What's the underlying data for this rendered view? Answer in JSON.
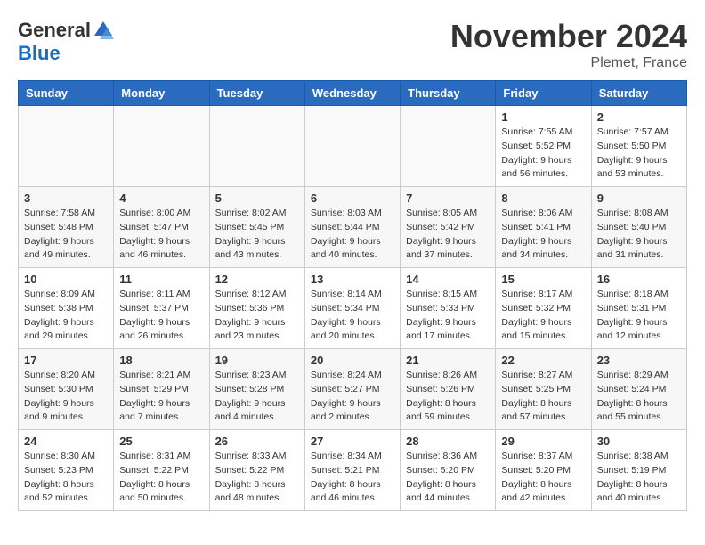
{
  "header": {
    "logo_line1": "General",
    "logo_line2": "Blue",
    "month": "November 2024",
    "location": "Plemet, France"
  },
  "weekdays": [
    "Sunday",
    "Monday",
    "Tuesday",
    "Wednesday",
    "Thursday",
    "Friday",
    "Saturday"
  ],
  "weeks": [
    [
      {
        "day": "",
        "info": ""
      },
      {
        "day": "",
        "info": ""
      },
      {
        "day": "",
        "info": ""
      },
      {
        "day": "",
        "info": ""
      },
      {
        "day": "",
        "info": ""
      },
      {
        "day": "1",
        "info": "Sunrise: 7:55 AM\nSunset: 5:52 PM\nDaylight: 9 hours\nand 56 minutes."
      },
      {
        "day": "2",
        "info": "Sunrise: 7:57 AM\nSunset: 5:50 PM\nDaylight: 9 hours\nand 53 minutes."
      }
    ],
    [
      {
        "day": "3",
        "info": "Sunrise: 7:58 AM\nSunset: 5:48 PM\nDaylight: 9 hours\nand 49 minutes."
      },
      {
        "day": "4",
        "info": "Sunrise: 8:00 AM\nSunset: 5:47 PM\nDaylight: 9 hours\nand 46 minutes."
      },
      {
        "day": "5",
        "info": "Sunrise: 8:02 AM\nSunset: 5:45 PM\nDaylight: 9 hours\nand 43 minutes."
      },
      {
        "day": "6",
        "info": "Sunrise: 8:03 AM\nSunset: 5:44 PM\nDaylight: 9 hours\nand 40 minutes."
      },
      {
        "day": "7",
        "info": "Sunrise: 8:05 AM\nSunset: 5:42 PM\nDaylight: 9 hours\nand 37 minutes."
      },
      {
        "day": "8",
        "info": "Sunrise: 8:06 AM\nSunset: 5:41 PM\nDaylight: 9 hours\nand 34 minutes."
      },
      {
        "day": "9",
        "info": "Sunrise: 8:08 AM\nSunset: 5:40 PM\nDaylight: 9 hours\nand 31 minutes."
      }
    ],
    [
      {
        "day": "10",
        "info": "Sunrise: 8:09 AM\nSunset: 5:38 PM\nDaylight: 9 hours\nand 29 minutes."
      },
      {
        "day": "11",
        "info": "Sunrise: 8:11 AM\nSunset: 5:37 PM\nDaylight: 9 hours\nand 26 minutes."
      },
      {
        "day": "12",
        "info": "Sunrise: 8:12 AM\nSunset: 5:36 PM\nDaylight: 9 hours\nand 23 minutes."
      },
      {
        "day": "13",
        "info": "Sunrise: 8:14 AM\nSunset: 5:34 PM\nDaylight: 9 hours\nand 20 minutes."
      },
      {
        "day": "14",
        "info": "Sunrise: 8:15 AM\nSunset: 5:33 PM\nDaylight: 9 hours\nand 17 minutes."
      },
      {
        "day": "15",
        "info": "Sunrise: 8:17 AM\nSunset: 5:32 PM\nDaylight: 9 hours\nand 15 minutes."
      },
      {
        "day": "16",
        "info": "Sunrise: 8:18 AM\nSunset: 5:31 PM\nDaylight: 9 hours\nand 12 minutes."
      }
    ],
    [
      {
        "day": "17",
        "info": "Sunrise: 8:20 AM\nSunset: 5:30 PM\nDaylight: 9 hours\nand 9 minutes."
      },
      {
        "day": "18",
        "info": "Sunrise: 8:21 AM\nSunset: 5:29 PM\nDaylight: 9 hours\nand 7 minutes."
      },
      {
        "day": "19",
        "info": "Sunrise: 8:23 AM\nSunset: 5:28 PM\nDaylight: 9 hours\nand 4 minutes."
      },
      {
        "day": "20",
        "info": "Sunrise: 8:24 AM\nSunset: 5:27 PM\nDaylight: 9 hours\nand 2 minutes."
      },
      {
        "day": "21",
        "info": "Sunrise: 8:26 AM\nSunset: 5:26 PM\nDaylight: 8 hours\nand 59 minutes."
      },
      {
        "day": "22",
        "info": "Sunrise: 8:27 AM\nSunset: 5:25 PM\nDaylight: 8 hours\nand 57 minutes."
      },
      {
        "day": "23",
        "info": "Sunrise: 8:29 AM\nSunset: 5:24 PM\nDaylight: 8 hours\nand 55 minutes."
      }
    ],
    [
      {
        "day": "24",
        "info": "Sunrise: 8:30 AM\nSunset: 5:23 PM\nDaylight: 8 hours\nand 52 minutes."
      },
      {
        "day": "25",
        "info": "Sunrise: 8:31 AM\nSunset: 5:22 PM\nDaylight: 8 hours\nand 50 minutes."
      },
      {
        "day": "26",
        "info": "Sunrise: 8:33 AM\nSunset: 5:22 PM\nDaylight: 8 hours\nand 48 minutes."
      },
      {
        "day": "27",
        "info": "Sunrise: 8:34 AM\nSunset: 5:21 PM\nDaylight: 8 hours\nand 46 minutes."
      },
      {
        "day": "28",
        "info": "Sunrise: 8:36 AM\nSunset: 5:20 PM\nDaylight: 8 hours\nand 44 minutes."
      },
      {
        "day": "29",
        "info": "Sunrise: 8:37 AM\nSunset: 5:20 PM\nDaylight: 8 hours\nand 42 minutes."
      },
      {
        "day": "30",
        "info": "Sunrise: 8:38 AM\nSunset: 5:19 PM\nDaylight: 8 hours\nand 40 minutes."
      }
    ]
  ]
}
